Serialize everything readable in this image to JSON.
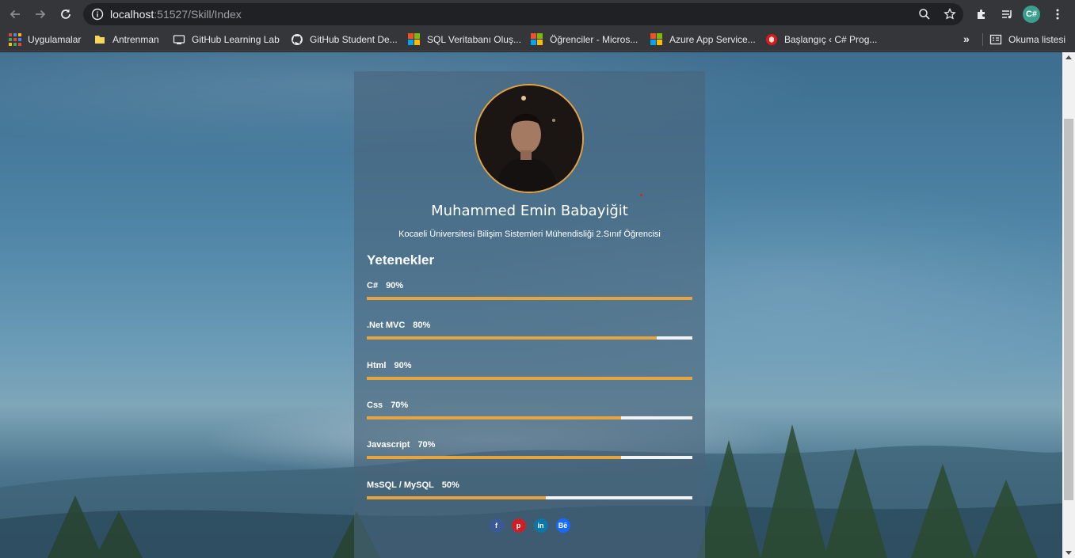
{
  "browser": {
    "url_host": "localhost",
    "url_path": ":51527/Skill/Index",
    "profile_initials": "C#"
  },
  "bookmarks": [
    {
      "label": "Uygulamalar",
      "icon": "apps-grid-icon"
    },
    {
      "label": "Antrenman",
      "icon": "folder-icon"
    },
    {
      "label": "GitHub Learning Lab",
      "icon": "github-learning-lab-icon"
    },
    {
      "label": "GitHub Student De...",
      "icon": "github-icon"
    },
    {
      "label": "SQL Veritabanı Oluş...",
      "icon": "microsoft-icon"
    },
    {
      "label": "Öğrenciler - Micros...",
      "icon": "microsoft-icon"
    },
    {
      "label": "Azure App Service...",
      "icon": "microsoft-icon"
    },
    {
      "label": "Başlangıç ‹ C# Prog...",
      "icon": "csharp-site-icon"
    }
  ],
  "reading_list": "Okuma listesi",
  "profile": {
    "name": "Muhammed Emin Babayiğit",
    "subtitle": "Kocaeli Üniversitesi Bilişim Sistemleri Mühendisliği 2.Sınıf Öğrencisi"
  },
  "skills": {
    "title": "Yetenekler",
    "items": [
      {
        "name": "C#",
        "percent_label": "90%",
        "level": 1.0
      },
      {
        "name": ".Net MVC",
        "percent_label": "80%",
        "level": 0.89
      },
      {
        "name": "Html",
        "percent_label": "90%",
        "level": 1.0
      },
      {
        "name": "Css",
        "percent_label": "70%",
        "level": 0.78
      },
      {
        "name": "Javascript",
        "percent_label": "70%",
        "level": 0.78
      },
      {
        "name": "MsSQL / MySQL",
        "percent_label": "50%",
        "level": 0.55
      }
    ]
  },
  "socials": [
    {
      "icon": "facebook-icon",
      "glyph": "f",
      "color": "#3b5998"
    },
    {
      "icon": "pinterest-icon",
      "glyph": "p",
      "color": "#cb2027"
    },
    {
      "icon": "linkedin-icon",
      "glyph": "in",
      "color": "#0e76a8"
    },
    {
      "icon": "behance-icon",
      "glyph": "Bē",
      "color": "#1769ff"
    }
  ],
  "colors": {
    "accent": "#e7a33d",
    "track": "#f2f2f2"
  }
}
